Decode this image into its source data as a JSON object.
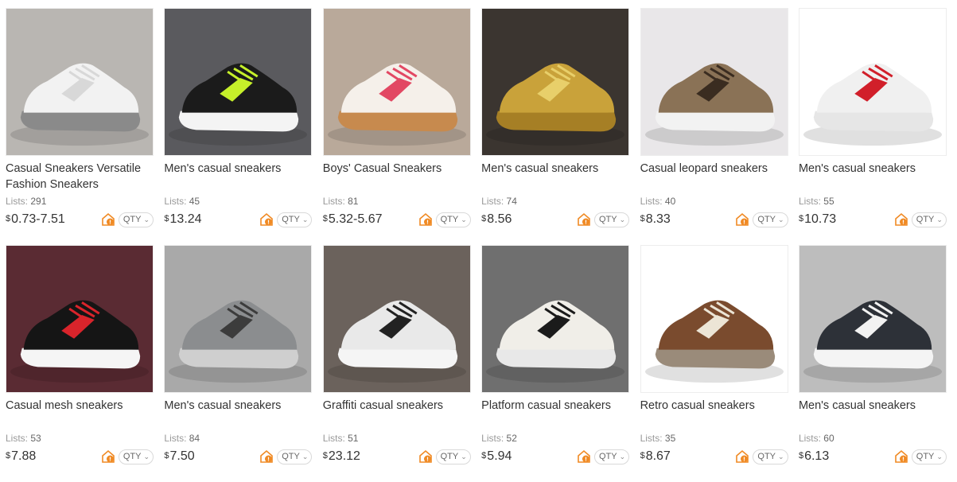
{
  "labels": {
    "lists_prefix": "Lists: ",
    "currency": "$",
    "qty": "QTY",
    "chevron": "⌄"
  },
  "products": [
    {
      "title": "Casual Sneakers Versatile Fashion Sneakers",
      "lists": "291",
      "price": "0.73-7.51",
      "bg": "#b9b6b2",
      "shoe": "#f2f2f2",
      "accent": "#d8d8d8",
      "sole": "#8a8a8a"
    },
    {
      "title": "Men's casual sneakers",
      "lists": "45",
      "price": "13.24",
      "bg": "#5a5a5e",
      "shoe": "#1b1b1b",
      "accent": "#c6f02a",
      "sole": "#f4f4f4"
    },
    {
      "title": "Boys' Casual Sneakers",
      "lists": "81",
      "price": "5.32-5.67",
      "bg": "#b9a99a",
      "shoe": "#f5f0ea",
      "accent": "#e24863",
      "sole": "#c78a4e"
    },
    {
      "title": "Men's casual sneakers",
      "lists": "74",
      "price": "8.56",
      "bg": "#3b3530",
      "shoe": "#c9a23a",
      "accent": "#e8cf6a",
      "sole": "#a67f25"
    },
    {
      "title": "Casual leopard sneakers",
      "lists": "40",
      "price": "8.33",
      "bg": "#e9e7e9",
      "shoe": "#8a7256",
      "accent": "#3a2c20",
      "sole": "#f2f2f2"
    },
    {
      "title": "Men's casual sneakers",
      "lists": "55",
      "price": "10.73",
      "bg": "#ffffff",
      "shoe": "#f0f0f0",
      "accent": "#d11f2a",
      "sole": "#e6e6e6"
    },
    {
      "title": "Casual mesh sneakers",
      "lists": "53",
      "price": "7.88",
      "bg": "#5a2b33",
      "shoe": "#151515",
      "accent": "#d9242b",
      "sole": "#f5f5f5"
    },
    {
      "title": "Men's casual sneakers",
      "lists": "84",
      "price": "7.50",
      "bg": "#a9a9a9",
      "shoe": "#8b8d8f",
      "accent": "#3c3c3c",
      "sole": "#cfcfcf"
    },
    {
      "title": "Graffiti casual sneakers",
      "lists": "51",
      "price": "23.12",
      "bg": "#6b625c",
      "shoe": "#e9e9e9",
      "accent": "#222222",
      "sole": "#f5f5f5"
    },
    {
      "title": "Platform casual sneakers",
      "lists": "52",
      "price": "5.94",
      "bg": "#6f6f6f",
      "shoe": "#f0eee8",
      "accent": "#1b1b1b",
      "sole": "#e8e8e8"
    },
    {
      "title": "Retro casual sneakers",
      "lists": "35",
      "price": "8.67",
      "bg": "#ffffff",
      "shoe": "#7a4b2e",
      "accent": "#ece5d6",
      "sole": "#9a8b7a"
    },
    {
      "title": "Men's casual sneakers",
      "lists": "60",
      "price": "6.13",
      "bg": "#bdbdbd",
      "shoe": "#2d3138",
      "accent": "#f2f2f2",
      "sole": "#f4f4f4"
    }
  ]
}
